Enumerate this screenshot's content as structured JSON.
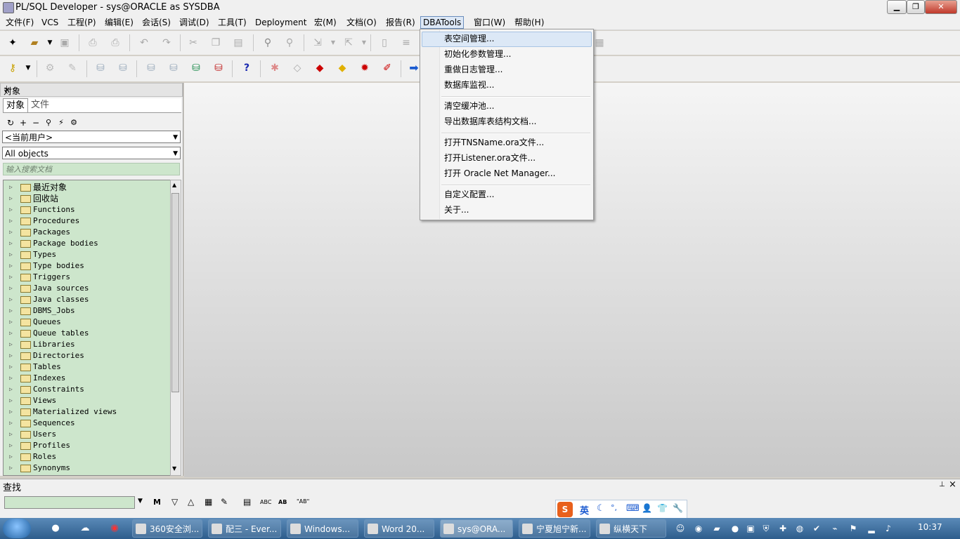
{
  "window": {
    "title": "PL/SQL Developer - sys@ORACLE as SYSDBA",
    "minimize_glyph": "▁",
    "maximize_glyph": "❐",
    "close_glyph": "✕"
  },
  "menubar": {
    "items": [
      {
        "label": "文件(F)"
      },
      {
        "label": "VCS"
      },
      {
        "label": "工程(P)"
      },
      {
        "label": "编辑(E)"
      },
      {
        "label": "会话(S)"
      },
      {
        "label": "调试(D)"
      },
      {
        "label": "工具(T)"
      },
      {
        "label": "Deployment"
      },
      {
        "label": "宏(M)"
      },
      {
        "label": "文档(O)"
      },
      {
        "label": "报告(R)"
      },
      {
        "label": "DBATools"
      },
      {
        "label": "窗口(W)"
      },
      {
        "label": "帮助(H)"
      }
    ],
    "active_item": "DBATools"
  },
  "toolbar_icons": {
    "row1": [
      "new-icon",
      "open-icon",
      "save-icon",
      "print-icon",
      "print-preview-icon",
      "undo-icon",
      "redo-icon",
      "cut-icon",
      "copy-icon",
      "paste-icon",
      "find-icon",
      "replace-icon",
      "import-icon",
      "export-icon",
      "document-icon",
      "indent-icon",
      "grid-icon"
    ],
    "row2": [
      "key-icon",
      "gear-icon",
      "pen-icon",
      "db-in-icon",
      "db-out-icon",
      "db-sql-icon",
      "db-green-icon",
      "db-red-icon",
      "help-icon",
      "tool1-icon",
      "eraser-icon",
      "red-cube-icon",
      "yellow-cube-icon",
      "red-gear-icon",
      "brush-icon",
      "arrow-icon"
    ]
  },
  "dbatools_menu": {
    "items": [
      {
        "label": "表空间管理..."
      },
      {
        "label": "初始化参数管理..."
      },
      {
        "label": "重做日志管理..."
      },
      {
        "label": "数据库监视..."
      },
      {
        "label": "清空缓冲池..."
      },
      {
        "label": "导出数据库表结构文档..."
      },
      {
        "label": "打开TNSName.ora文件..."
      },
      {
        "label": "打开Listener.ora文件..."
      },
      {
        "label": "打开 Oracle Net Manager..."
      },
      {
        "label": "自定义配置..."
      },
      {
        "label": "关于..."
      }
    ],
    "highlighted_index": 0
  },
  "object_browser": {
    "header": "对象",
    "pin_glyph": "⊥",
    "close_glyph": "×",
    "tabs": [
      {
        "label": "对象"
      },
      {
        "label": "文件"
      }
    ],
    "user_filter": "<当前用户>",
    "object_filter": "All objects",
    "search_placeholder": "输入搜索文档",
    "tree_items": [
      {
        "label": "最近对象",
        "cjk": true
      },
      {
        "label": "回收站",
        "cjk": true
      },
      {
        "label": "Functions"
      },
      {
        "label": "Procedures"
      },
      {
        "label": "Packages"
      },
      {
        "label": "Package bodies"
      },
      {
        "label": "Types"
      },
      {
        "label": "Type bodies"
      },
      {
        "label": "Triggers"
      },
      {
        "label": "Java sources"
      },
      {
        "label": "Java classes"
      },
      {
        "label": "DBMS_Jobs"
      },
      {
        "label": "Queues"
      },
      {
        "label": "Queue tables"
      },
      {
        "label": "Libraries"
      },
      {
        "label": "Directories"
      },
      {
        "label": "Tables"
      },
      {
        "label": "Indexes"
      },
      {
        "label": "Constraints"
      },
      {
        "label": "Views"
      },
      {
        "label": "Materialized views"
      },
      {
        "label": "Sequences"
      },
      {
        "label": "Users"
      },
      {
        "label": "Profiles"
      },
      {
        "label": "Roles"
      },
      {
        "label": "Synonyms"
      }
    ]
  },
  "find_bar": {
    "label": "查找",
    "pin_glyph": "⊥",
    "close_glyph": "×",
    "input_value": "",
    "buttons": [
      {
        "name": "find-icon",
        "glyph": "M"
      },
      {
        "name": "find-next-icon",
        "glyph": "▽"
      },
      {
        "name": "find-prev-icon",
        "glyph": "△"
      },
      {
        "name": "highlight-icon",
        "glyph": "▦"
      },
      {
        "name": "eraser-icon",
        "glyph": "✎"
      },
      {
        "name": "selection-icon",
        "glyph": "▤"
      },
      {
        "name": "case-icon",
        "glyph": "ABC"
      },
      {
        "name": "whole-word-icon",
        "glyph": "AB"
      },
      {
        "name": "quote-icon",
        "glyph": "\"AB\""
      }
    ]
  },
  "ime_bar": {
    "logo": "S",
    "mode": "英",
    "icons": [
      "☾",
      "°,",
      "⌨",
      "👤",
      "👕",
      "🔧"
    ]
  },
  "taskbar": {
    "tasks": [
      {
        "label": "360安全浏..."
      },
      {
        "label": "配三 - Ever..."
      },
      {
        "label": "Windows..."
      },
      {
        "label": "Word 20..."
      },
      {
        "label": "sys@ORA...",
        "active": true
      },
      {
        "label": "宁夏旭宁新..."
      },
      {
        "label": "纵横天下"
      }
    ],
    "clock": "10:37"
  }
}
